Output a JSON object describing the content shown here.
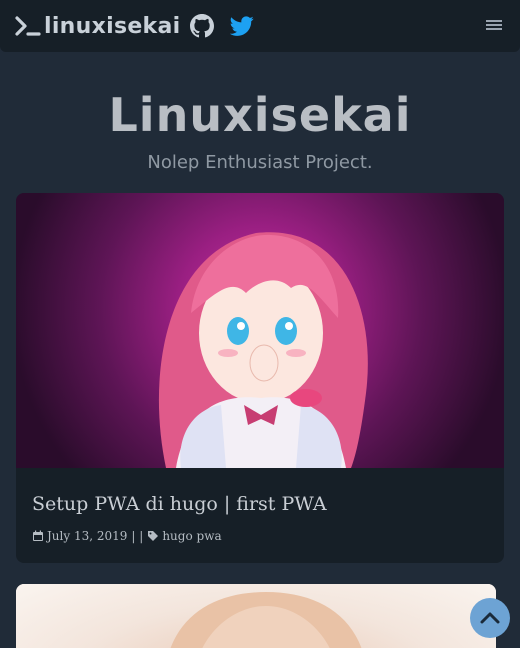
{
  "nav": {
    "brand_text": "linuxisekai",
    "icons": [
      "terminal-icon",
      "github-icon",
      "twitter-icon",
      "hamburger-menu-icon"
    ]
  },
  "hero": {
    "title": "Linuxisekai",
    "subtitle": "Nolep Enthusiast Project."
  },
  "posts": [
    {
      "title": "Setup PWA di hugo | first PWA",
      "date": "July 13, 2019",
      "separator": "| |",
      "tags": "hugo pwa"
    }
  ],
  "colors": {
    "background": "#202b38",
    "navbar": "#161f27",
    "card": "#161f27",
    "accent": "#6da3d4",
    "twitter": "#1da1f2"
  }
}
